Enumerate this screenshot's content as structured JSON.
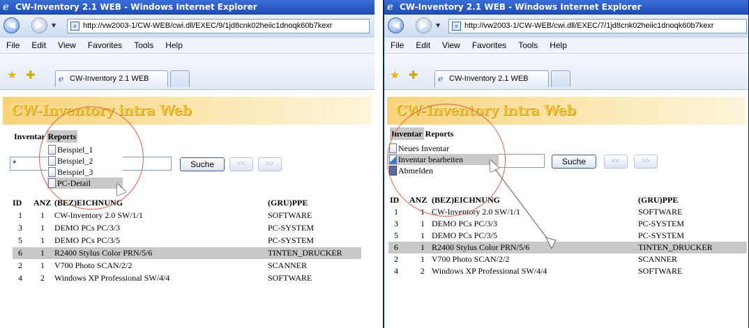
{
  "windows": [
    {
      "title": "CW-Inventory 2.1 WEB - Windows Internet Explorer",
      "address": "http://vw2003-1/CW-WEB/cwi.dll/EXEC/9/1jd8cnk02heiic1dnoqk60b7kexr",
      "menus": [
        "File",
        "Edit",
        "View",
        "Favorites",
        "Tools",
        "Help"
      ],
      "tab_label": "CW-Inventory 2.1 WEB",
      "banner": "CW-Inventory intra Web",
      "app_menu": {
        "inventar": "Inventar",
        "reports": "Reports",
        "active": "Reports"
      },
      "dropdown": [
        "Beispiel_1",
        "Beispiel_2",
        "Beispiel_3",
        "PC-Detail"
      ],
      "dropdown_highlight": "PC-Detail",
      "search_value": "*",
      "buttons": {
        "search": "Suche",
        "prev": "<<",
        "next": ">>"
      },
      "columns": [
        "ID",
        "ANZ",
        "(BEZ)EICHNUNG",
        "(GRU)PPE"
      ],
      "rows": [
        {
          "id": "1",
          "anz": "1",
          "bez": "CW-Inventory 2.0 SW/1/1",
          "gru": "SOFTWARE"
        },
        {
          "id": "3",
          "anz": "1",
          "bez": "DEMO PCs PC/3/3",
          "gru": "PC-SYSTEM"
        },
        {
          "id": "5",
          "anz": "1",
          "bez": "DEMO PCs PC/3/5",
          "gru": "PC-SYSTEM"
        },
        {
          "id": "6",
          "anz": "1",
          "bez": "R2400 Stylus Color PRN/5/6",
          "gru": "TINTEN_DRUCKER"
        },
        {
          "id": "2",
          "anz": "1",
          "bez": "V700 Photo SCAN/2/2",
          "gru": "SCANNER"
        },
        {
          "id": "4",
          "anz": "2",
          "bez": "Windows XP Professional SW/4/4",
          "gru": "SOFTWARE"
        }
      ],
      "highlight_row_id": "6"
    },
    {
      "title": "CW-Inventory 2.1 WEB - Windows Internet Explorer",
      "address": "http://vw2003-1/CW-WEB/cwi.dll/EXEC/7/1jd8cnk02heiic1dnoqk60b7kexr",
      "menus": [
        "File",
        "Edit",
        "View",
        "Favorites",
        "Tools",
        "Help"
      ],
      "tab_label": "CW-Inventory 2.1 WEB",
      "banner": "CW-Inventory intra Web",
      "app_menu": {
        "inventar": "Inventar",
        "reports": "Reports",
        "active": "Inventar"
      },
      "dropdown": [
        "Neues Inventar",
        "Inventar bearbeiten",
        "Abmelden"
      ],
      "dropdown_highlight": "Inventar bearbeiten",
      "search_value": "",
      "buttons": {
        "search": "Suche",
        "prev": "<<",
        "next": ">>"
      },
      "columns": [
        "ID",
        "ANZ",
        "(BEZ)EICHNUNG",
        "(GRU)PPE"
      ],
      "rows": [
        {
          "id": "1",
          "anz": "1",
          "bez": "CW-Inventory 2.0 SW/1/1",
          "gru": "SOFTWARE"
        },
        {
          "id": "3",
          "anz": "1",
          "bez": "DEMO PCs PC/3/3",
          "gru": "PC-SYSTEM"
        },
        {
          "id": "5",
          "anz": "1",
          "bez": "DEMO PCs PC/3/5",
          "gru": "PC-SYSTEM"
        },
        {
          "id": "6",
          "anz": "1",
          "bez": "R2400 Stylus Color PRN/5/6",
          "gru": "TINTEN_DRUCKER"
        },
        {
          "id": "2",
          "anz": "1",
          "bez": "V700 Photo SCAN/2/2",
          "gru": "SCANNER"
        },
        {
          "id": "4",
          "anz": "2",
          "bez": "Windows XP Professional SW/4/4",
          "gru": "SOFTWARE"
        }
      ],
      "highlight_row_id": "6"
    }
  ],
  "colors": {
    "titlebar": "#1e4bb0",
    "highlight": "#c8c8c8",
    "annotation_circle": "#e06040"
  }
}
